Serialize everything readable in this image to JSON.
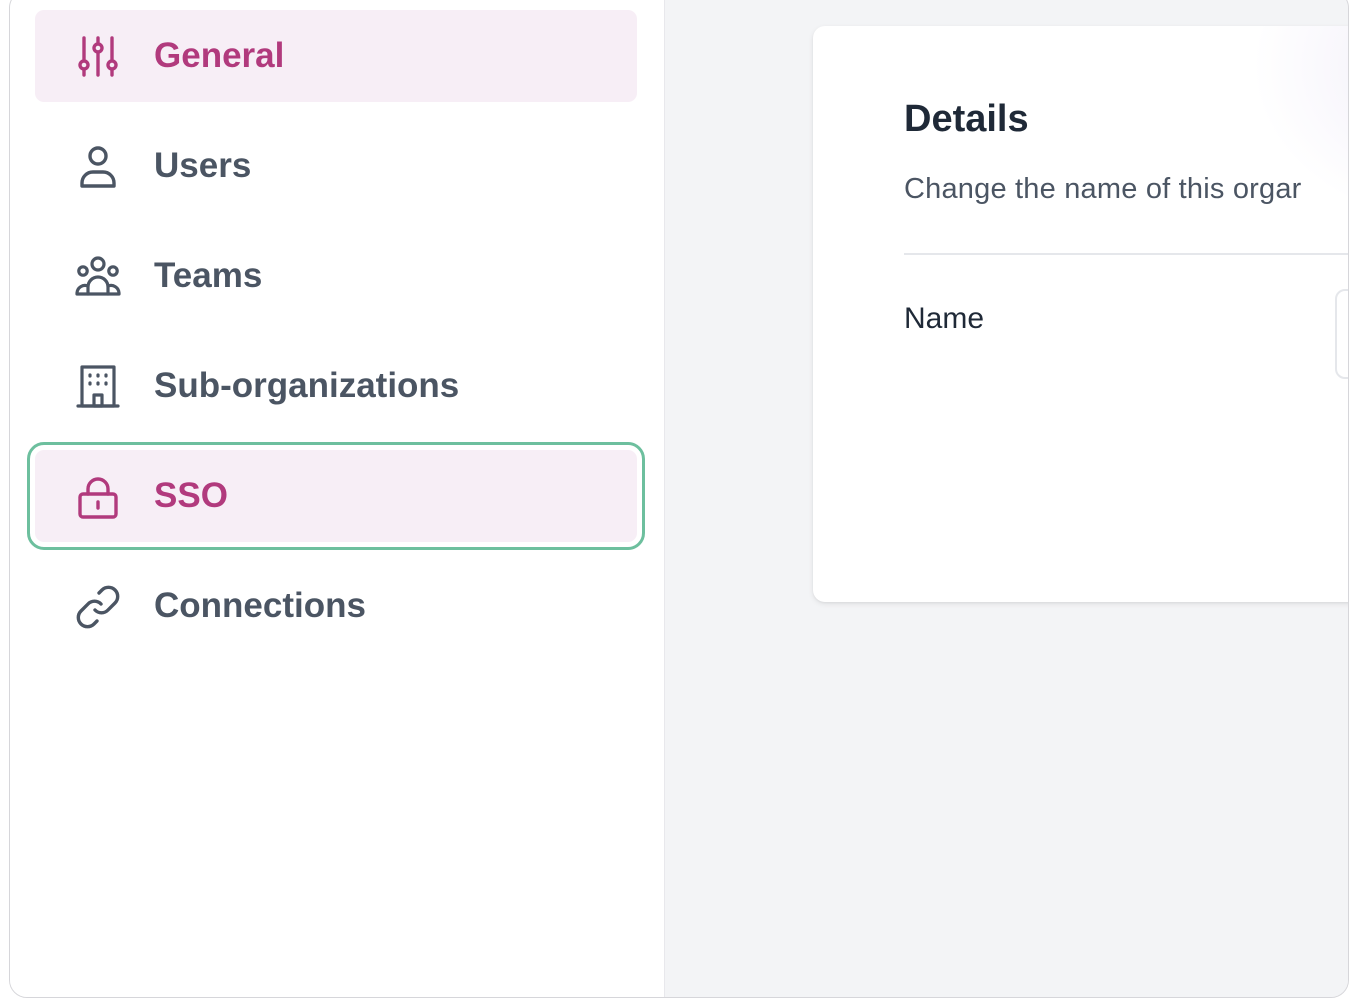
{
  "sidebar": {
    "items": [
      {
        "label": "General",
        "icon": "sliders-icon",
        "active": true
      },
      {
        "label": "Users",
        "icon": "user-icon",
        "active": false
      },
      {
        "label": "Teams",
        "icon": "users-group-icon",
        "active": false
      },
      {
        "label": "Sub-organizations",
        "icon": "building-icon",
        "active": false
      },
      {
        "label": "SSO",
        "icon": "lock-icon",
        "active": true,
        "focused": true
      },
      {
        "label": "Connections",
        "icon": "link-icon",
        "active": false
      }
    ]
  },
  "details": {
    "title": "Details",
    "subtitle": "Change the name of this orgar",
    "name_label": "Name",
    "name_value": ""
  },
  "colors": {
    "accent": "#b13a7d",
    "active_bg": "#f7eef6",
    "focus_ring": "#6dbf9e",
    "text_muted": "#4b5563",
    "page_bg": "#f3f4f6"
  }
}
